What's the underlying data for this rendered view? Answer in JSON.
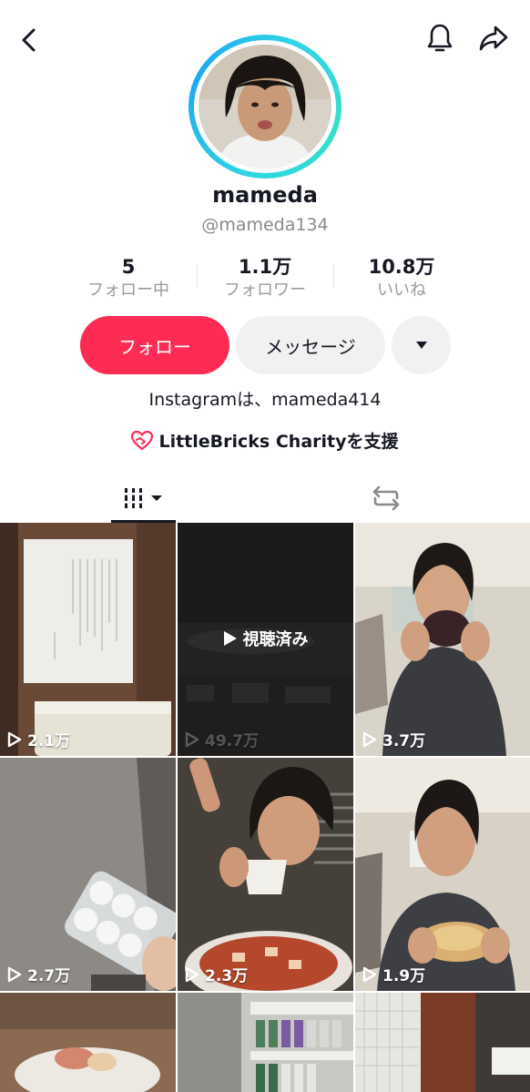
{
  "profile": {
    "username": "mameda",
    "handle": "@mameda134",
    "bio": "Instagramは、mameda414",
    "charity": "LittleBricks Charityを支援"
  },
  "stats": [
    {
      "value": "5",
      "label": "フォロー中"
    },
    {
      "value": "1.1万",
      "label": "フォロワー"
    },
    {
      "value": "10.8万",
      "label": "いいね"
    }
  ],
  "actions": {
    "follow_label": "フォロー",
    "message_label": "メッセージ"
  },
  "videos": [
    {
      "views": "2.1万"
    },
    {
      "views": "49.7万",
      "watched_label": "視聴済み"
    },
    {
      "views": "3.7万"
    },
    {
      "views": "2.7万"
    },
    {
      "views": "2.3万"
    },
    {
      "views": "1.9万"
    },
    {
      "views": ""
    },
    {
      "views": ""
    },
    {
      "views": ""
    }
  ],
  "colors": {
    "accent": "#fe2c55",
    "ring": "#2fd3e6",
    "text": "#161823",
    "muted": "#8a8b91"
  },
  "icons": {
    "back": "chevron-left-icon",
    "bell": "bell-icon",
    "share": "share-arrow-icon",
    "more": "caret-down-icon",
    "grid": "video-grid-icon",
    "repost": "repost-icon",
    "charity": "heart-hands-icon",
    "play": "play-icon"
  }
}
